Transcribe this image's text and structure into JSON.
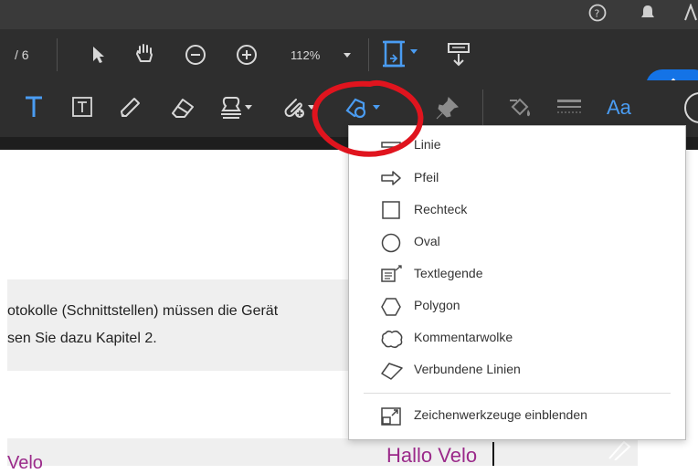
{
  "toolbar": {
    "page_count": "/ 6",
    "zoom_value": "112%",
    "text_style_label": "Aa",
    "share_icon": "share-icon"
  },
  "document": {
    "line1": "otokolle (Schnittstellen) müssen die Gerät",
    "line2": "sen Sie dazu Kapitel 2.",
    "comment_text": "Hallo Velo",
    "left_fragment": "Velo"
  },
  "menu": {
    "items": [
      {
        "label": "Linie",
        "icon": "line-icon"
      },
      {
        "label": "Pfeil",
        "icon": "arrow-icon"
      },
      {
        "label": "Rechteck",
        "icon": "rectangle-icon"
      },
      {
        "label": "Oval",
        "icon": "oval-icon"
      },
      {
        "label": "Textlegende",
        "icon": "callout-icon"
      },
      {
        "label": "Polygon",
        "icon": "polygon-icon"
      },
      {
        "label": "Kommentarwolke",
        "icon": "cloud-icon"
      },
      {
        "label": "Verbundene Linien",
        "icon": "polyline-icon"
      }
    ],
    "show_tools": {
      "label": "Zeichenwerkzeuge einblenden",
      "icon": "expand-tools-icon"
    }
  },
  "colors": {
    "toolbar_bg": "#2e2e2e",
    "accent_blue": "#1473e6",
    "annotation_red": "#e0141e",
    "comment_purple": "#9b2a8a"
  }
}
